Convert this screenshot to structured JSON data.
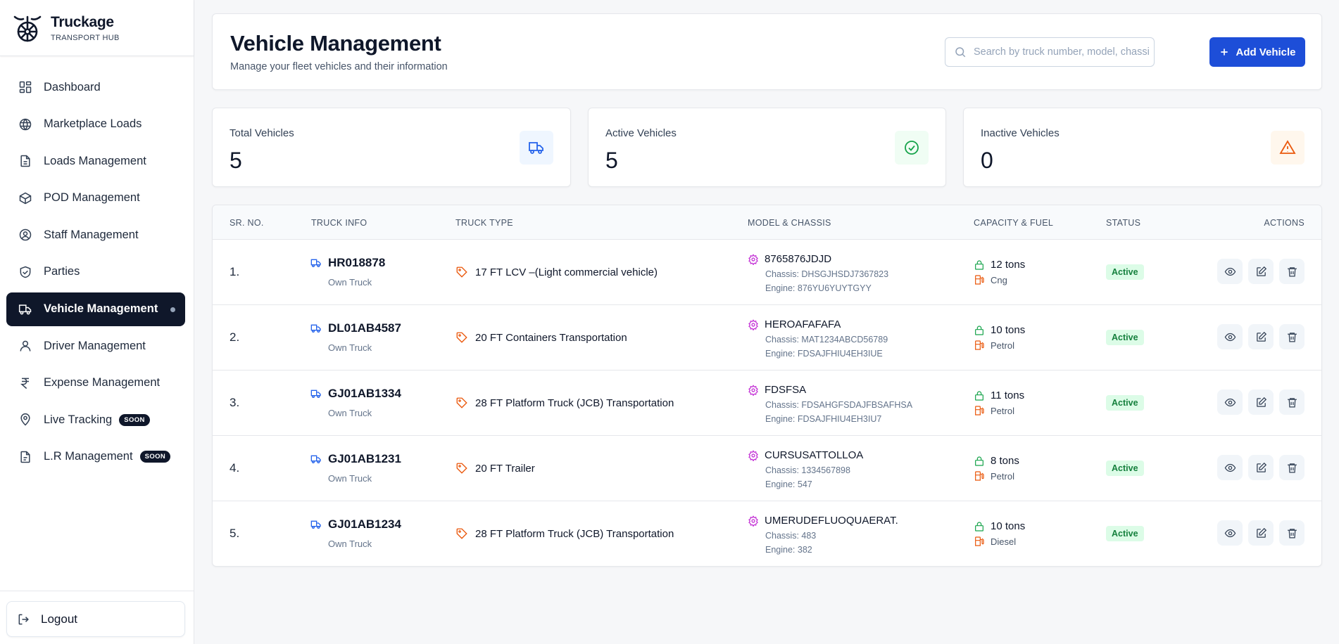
{
  "brand": {
    "name": "Truckage",
    "subtitle": "TRANSPORT HUB"
  },
  "sidebar": {
    "items": [
      {
        "label": "Dashboard",
        "icon": "dashboard-icon"
      },
      {
        "label": "Marketplace Loads",
        "icon": "globe-icon"
      },
      {
        "label": "Loads Management",
        "icon": "document-icon"
      },
      {
        "label": "POD Management",
        "icon": "package-icon"
      },
      {
        "label": "Staff Management",
        "icon": "user-circle-icon"
      },
      {
        "label": "Parties",
        "icon": "handshake-icon"
      },
      {
        "label": "Vehicle Management",
        "icon": "truck-icon",
        "active": true
      },
      {
        "label": "Driver Management",
        "icon": "user-icon"
      },
      {
        "label": "Expense Management",
        "icon": "rupee-icon"
      },
      {
        "label": "Live Tracking",
        "icon": "map-pin-icon",
        "badge": "SOON"
      },
      {
        "label": "L.R Management",
        "icon": "file-text-icon",
        "badge": "SOON"
      }
    ],
    "logout_label": "Logout"
  },
  "header": {
    "title": "Vehicle Management",
    "subtitle": "Manage your fleet vehicles and their information",
    "search_placeholder": "Search by truck number, model, chassis, or engine",
    "add_label": "Add Vehicle"
  },
  "stats": [
    {
      "label": "Total Vehicles",
      "value": "5",
      "icon": "truck-icon",
      "color": "#2563eb",
      "bg": "#eff6ff"
    },
    {
      "label": "Active Vehicles",
      "value": "5",
      "icon": "check-circle-icon",
      "color": "#16a34a",
      "bg": "#f0fdf4"
    },
    {
      "label": "Inactive Vehicles",
      "value": "0",
      "icon": "warning-icon",
      "color": "#ea580c",
      "bg": "#fff7ed"
    }
  ],
  "table": {
    "columns": [
      "SR. NO.",
      "TRUCK INFO",
      "TRUCK TYPE",
      "MODEL & CHASSIS",
      "CAPACITY & FUEL",
      "STATUS",
      "ACTIONS"
    ],
    "rows": [
      {
        "sr": "1.",
        "truck": "HR018878",
        "own": "Own Truck",
        "type": "17 FT LCV –(Light commercial vehicle)",
        "model": "8765876JDJD",
        "chassis": "Chassis: DHSGJHSDJ7367823",
        "engine": "Engine: 876YU6YUYTGYY",
        "capacity": "12 tons",
        "fuel": "Cng",
        "status": "Active"
      },
      {
        "sr": "2.",
        "truck": "DL01AB4587",
        "own": "Own Truck",
        "type": "20 FT Containers Transportation",
        "model": "HEROAFAFAFA",
        "chassis": "Chassis: MAT1234ABCD56789",
        "engine": "Engine: FDSAJFHIU4EH3IUE",
        "capacity": "10 tons",
        "fuel": "Petrol",
        "status": "Active"
      },
      {
        "sr": "3.",
        "truck": "GJ01AB1334",
        "own": "Own Truck",
        "type": "28 FT Platform Truck (JCB) Transportation",
        "model": "FDSFSA",
        "chassis": "Chassis: FDSAHGFSDAJFBSAFHSA",
        "engine": "Engine: FDSAJFHIU4EH3IU7",
        "capacity": "11 tons",
        "fuel": "Petrol",
        "status": "Active"
      },
      {
        "sr": "4.",
        "truck": "GJ01AB1231",
        "own": "Own Truck",
        "type": "20 FT Trailer",
        "model": "CURSUSATTOLLOA",
        "chassis": "Chassis: 1334567898",
        "engine": "Engine: 547",
        "capacity": "8 tons",
        "fuel": "Petrol",
        "status": "Active"
      },
      {
        "sr": "5.",
        "truck": "GJ01AB1234",
        "own": "Own Truck",
        "type": "28 FT Platform Truck (JCB) Transportation",
        "model": "UMERUDEFLUOQUAERAT.",
        "chassis": "Chassis: 483",
        "engine": "Engine: 382",
        "capacity": "10 tons",
        "fuel": "Diesel",
        "status": "Active"
      }
    ]
  }
}
